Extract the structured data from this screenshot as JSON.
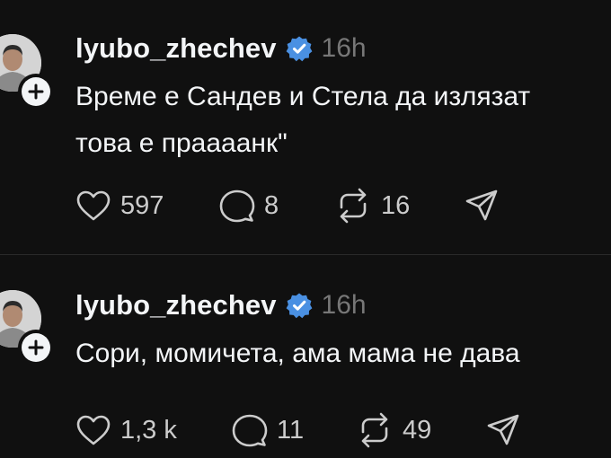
{
  "posts": [
    {
      "username": "lyubo_zhechev",
      "time": "16h",
      "lines": [
        "Време е Сандев и Стела да излязат",
        "това е праааанк\""
      ],
      "likes": "597",
      "replies": "8",
      "reposts": "16"
    },
    {
      "username": "lyubo_zhechev",
      "time": "16h",
      "lines": [
        "Сори, момичета, ама мама не дава"
      ],
      "likes": "1,3 k",
      "replies": "11",
      "reposts": "49"
    }
  ],
  "colors": {
    "background": "#101010",
    "text": "#f3f5f7",
    "muted": "#777777",
    "verified": "#4a90e2"
  },
  "icons": [
    "heart-icon",
    "comment-icon",
    "repost-icon",
    "share-icon",
    "verified-icon",
    "plus-icon"
  ]
}
